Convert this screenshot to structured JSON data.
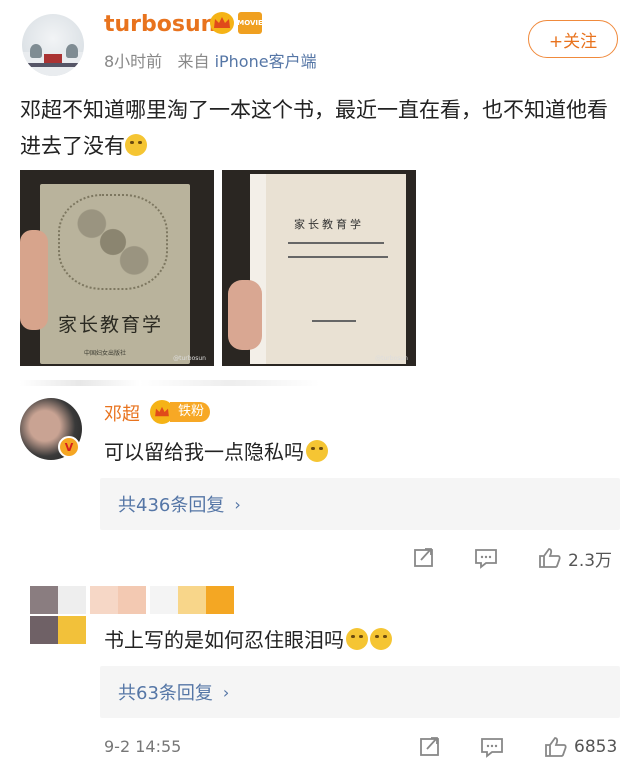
{
  "post": {
    "username": "turbosun",
    "movie_badge": "MOVIE",
    "time": "8小时前",
    "source_prefix": "来自",
    "source": "iPhone客户端",
    "follow_label": "+关注",
    "text": "邓超不知道哪里淘了一本这个书，最近一直在看，也不知道他看进去了没有"
  },
  "images": [
    {
      "icon": "book-cover-photo",
      "book_title": "家长教育学",
      "publisher": "中国妇女出版社",
      "watermark": "@turbosun"
    },
    {
      "icon": "book-title-page-photo",
      "book_title": "家长教育学",
      "publisher": "中国妇女出版社",
      "watermark": "@turbosun"
    }
  ],
  "comments": [
    {
      "name": "邓超",
      "fan_badge": "铁粉",
      "verified_icon": "v-icon",
      "text": "可以留给我一点隐私吗",
      "replies_label": "共436条回复",
      "likes": "2.3万"
    },
    {
      "text": "书上写的是如何忍住眼泪吗",
      "replies_label": "共63条回复",
      "timestamp": "9-2 14:55",
      "likes": "6853"
    }
  ],
  "colors": {
    "username": "#e8731e",
    "link": "#5576a6",
    "badge": "#f5b316"
  }
}
